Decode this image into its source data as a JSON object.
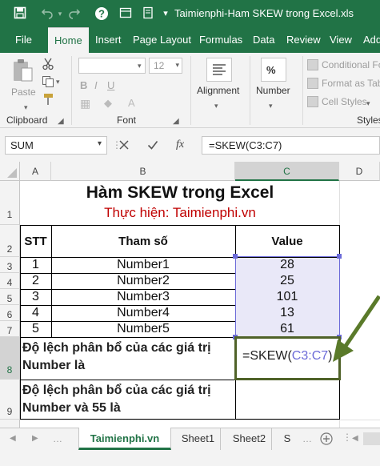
{
  "window": {
    "title": "Taimienphi-Ham SKEW trong Excel.xls"
  },
  "tabs": [
    {
      "label": "File"
    },
    {
      "label": "Home"
    },
    {
      "label": "Insert"
    },
    {
      "label": "Page Layout"
    },
    {
      "label": "Formulas"
    },
    {
      "label": "Data"
    },
    {
      "label": "Review"
    },
    {
      "label": "View"
    },
    {
      "label": "Add"
    }
  ],
  "ribbon": {
    "clipboard_label": "Clipboard",
    "paste_label": "Paste",
    "font_label": "Font",
    "font_size": "12",
    "alignment_label": "Alignment",
    "number_label": "Number",
    "conditional_formatting": "Conditional Fo",
    "format_as_table": "Format as Tab",
    "cell_styles": "Cell Styles",
    "styles_label": "Styles"
  },
  "formula_bar": {
    "name_box": "SUM",
    "fx": "fx",
    "formula": "=SKEW(C3:C7)"
  },
  "columns": [
    "A",
    "B",
    "C",
    "D"
  ],
  "rows": [
    "1",
    "2",
    "3",
    "4",
    "5",
    "6",
    "7",
    "8",
    "9"
  ],
  "sheet": {
    "title": "Hàm SKEW trong Excel",
    "subtitle": "Thực hiện: Taimienphi.vn",
    "header_stt": "STT",
    "header_param": "Tham số",
    "header_value": "Value",
    "table": [
      {
        "stt": "1",
        "param": "Number1",
        "value": "28"
      },
      {
        "stt": "2",
        "param": "Number2",
        "value": "25"
      },
      {
        "stt": "3",
        "param": "Number3",
        "value": "101"
      },
      {
        "stt": "4",
        "param": "Number4",
        "value": "13"
      },
      {
        "stt": "5",
        "param": "Number5",
        "value": "61"
      }
    ],
    "row8_label": "Độ lệch phân bổ của các giá trị Number là",
    "row8_formula_prefix": "=SKEW(",
    "row8_formula_ref": "C3:C7",
    "row8_formula_suffix": ")",
    "row9_label": "Độ lệch phân bổ của các giá trị Number và 55 là"
  },
  "sheet_tabs": [
    {
      "label": "Taimienphi.vn"
    },
    {
      "label": "Sheet1"
    },
    {
      "label": "Sheet2"
    },
    {
      "label": "S"
    }
  ],
  "colors": {
    "excel_green": "#217346",
    "range_blue": "#6c6bd8",
    "highlight_fill": "#e9e8f8",
    "active_cell_border": "#4f6228",
    "arrow": "#5a7a2a",
    "subtitle_red": "#c00000"
  }
}
